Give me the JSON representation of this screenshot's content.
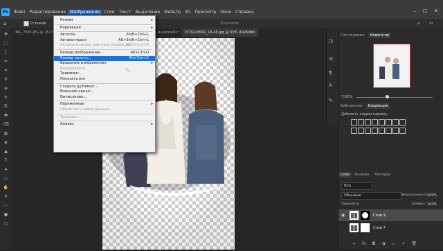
{
  "app": {
    "logo": "Ps"
  },
  "menu": [
    "Файл",
    "Редактирование",
    "Изображение",
    "Слои",
    "Текст",
    "Выделение",
    "Фильтр",
    "3D",
    "Просмотр",
    "Окно",
    "Справка"
  ],
  "menu_active_index": 2,
  "options": {
    "antialias_label": "Сглажив",
    "threed_mode": "3D-режим:"
  },
  "tabs": [
    {
      "label": "IMG_7695.JPG @ 28,1%"
    },
    {
      "label": "й-маска/8) *"
    },
    {
      "label": "1579228092_16-40.jpg @ 50% (RGB/8#)"
    }
  ],
  "dropdown": {
    "items": [
      {
        "label": "Режим",
        "shortcut": "",
        "submenu": true,
        "disabled": false
      },
      {
        "sep": true
      },
      {
        "label": "Коррекция",
        "shortcut": "",
        "submenu": true,
        "disabled": false
      },
      {
        "sep": true
      },
      {
        "label": "Автотон",
        "shortcut": "Shift+Ctrl+L",
        "disabled": false
      },
      {
        "label": "Автоконтраст",
        "shortcut": "Alt+Shift+Ctrl+L",
        "disabled": false
      },
      {
        "label": "Автоматическая цветовая коррекция",
        "shortcut": "Shift+Ctrl+B",
        "disabled": true
      },
      {
        "sep": true
      },
      {
        "label": "Размер изображения...",
        "shortcut": "Alt+Ctrl+I",
        "disabled": false
      },
      {
        "label": "Размер холста...",
        "shortcut": "Alt+Ctrl+C",
        "disabled": false,
        "highlight": true
      },
      {
        "label": "Вращение изображения",
        "shortcut": "",
        "submenu": true,
        "disabled": false
      },
      {
        "label": "Кадрировать",
        "shortcut": "",
        "disabled": true
      },
      {
        "label": "Тримминг...",
        "shortcut": "",
        "disabled": false
      },
      {
        "label": "Показать все",
        "shortcut": "",
        "disabled": false
      },
      {
        "sep": true
      },
      {
        "label": "Создать дубликат...",
        "shortcut": "",
        "disabled": false
      },
      {
        "label": "Внешний канал...",
        "shortcut": "",
        "disabled": false
      },
      {
        "label": "Вычисления...",
        "shortcut": "",
        "disabled": false
      },
      {
        "sep": true
      },
      {
        "label": "Переменные",
        "shortcut": "",
        "submenu": true,
        "disabled": false
      },
      {
        "label": "Применить набор данных...",
        "shortcut": "",
        "disabled": true
      },
      {
        "sep": true
      },
      {
        "label": "Треппинг...",
        "shortcut": "",
        "disabled": true
      },
      {
        "sep": true
      },
      {
        "label": "Анализ",
        "shortcut": "",
        "submenu": true,
        "disabled": false
      }
    ]
  },
  "panels": {
    "nav_tabs": [
      "Гистограмма",
      "Навигатор"
    ],
    "zoom": "7,92%",
    "adj_tabs": [
      "Библиотеки",
      "Коррекция"
    ],
    "adj_hint": "Добавить корректировку",
    "layer_tabs": [
      "Слои",
      "Каналы",
      "Контуры"
    ],
    "kind": "Вид",
    "blend_mode": "Обычные",
    "opacity_label": "Непрозрачность:",
    "opacity_value": "100%",
    "lock_label": "Закрепить:",
    "fill_label": "Заливка:",
    "fill_value": "100%",
    "layers": [
      {
        "name": "Слой 9",
        "selected": true
      },
      {
        "name": "Слой 7",
        "selected": false
      }
    ]
  },
  "colors": {
    "accent": "#31a8ff",
    "highlight": "#1e6fd6",
    "menu_bg": "#f0f0f0",
    "nav_frame": "#e03030"
  }
}
